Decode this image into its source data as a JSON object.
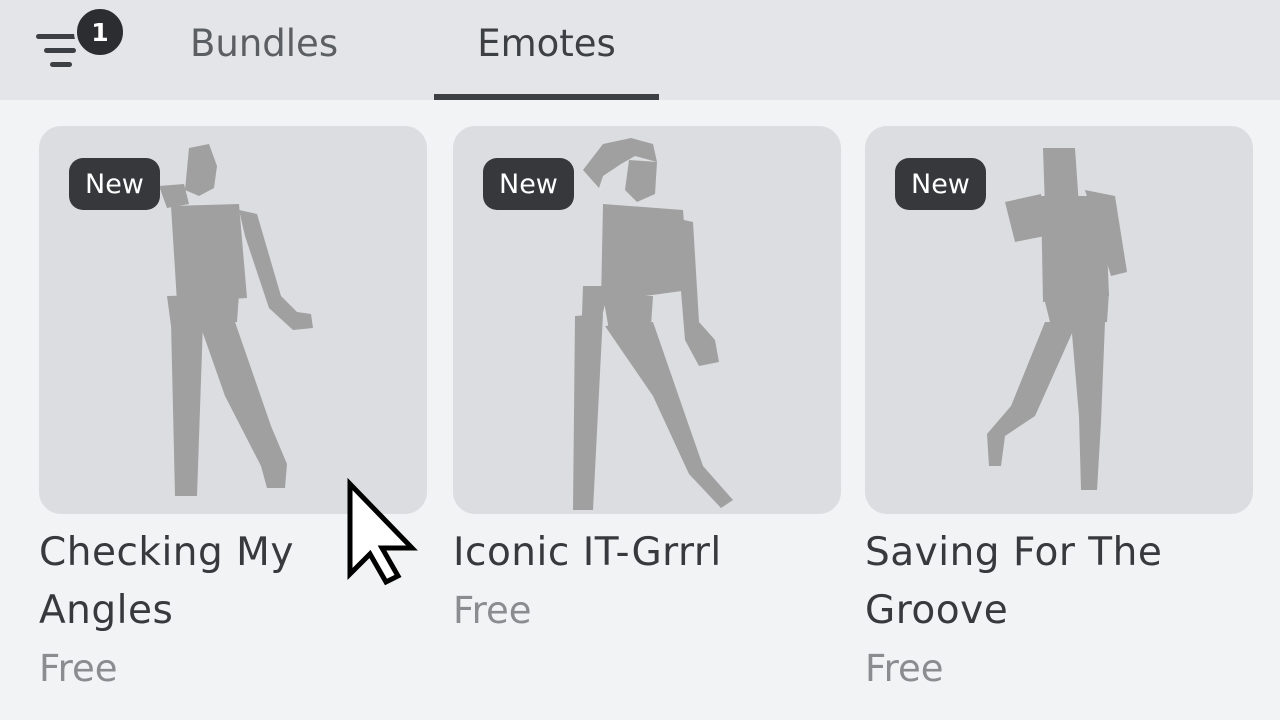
{
  "filter": {
    "badge_count": "1",
    "icon": "filter-lines-icon"
  },
  "tabs": [
    {
      "label": "Bundles",
      "active": false
    },
    {
      "label": "Emotes",
      "active": true
    }
  ],
  "items": [
    {
      "badge": "New",
      "name": "Checking My Angles",
      "price": "Free"
    },
    {
      "badge": "New",
      "name": "Iconic IT-Grrrl",
      "price": "Free"
    },
    {
      "badge": "New",
      "name": "Saving For The Groove",
      "price": "Free"
    }
  ],
  "colors": {
    "topbar": "#e3e5e8",
    "background": "#f2f3f5",
    "badge_dark": "#36383b",
    "silhouette": "#a0a0a0"
  }
}
